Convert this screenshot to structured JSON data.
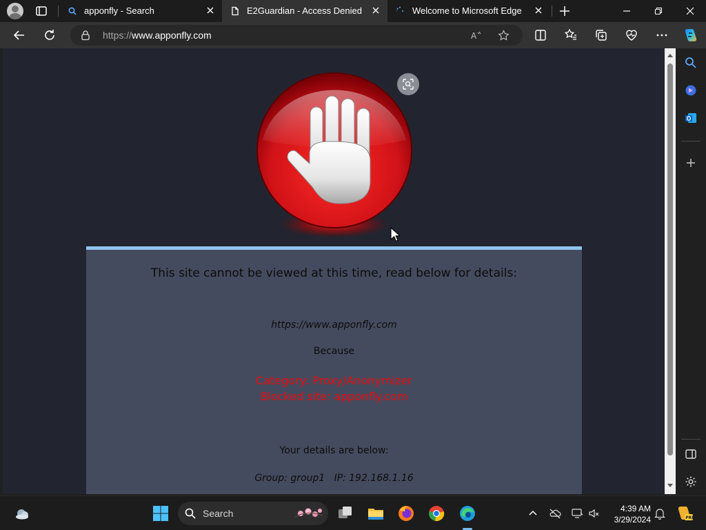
{
  "tabs": [
    {
      "title": "apponfly - Search",
      "icon": "search-icon",
      "active": false
    },
    {
      "title": "E2Guardian - Access Denied",
      "icon": "document-icon",
      "active": true
    },
    {
      "title": "Welcome to Microsoft Edge",
      "icon": "loading-icon",
      "active": false
    }
  ],
  "address_bar": {
    "scheme": "https://",
    "host": "www.apponfly.com"
  },
  "block_page": {
    "heading": "This site cannot be viewed at this time, read below for details:",
    "url": "https://www.apponfly.com",
    "because": "Because",
    "reason_line1": "Category: Proxy/Anonymizer",
    "reason_line2": "Blocked site: apponfly.com",
    "details_heading": "Your details are below:",
    "details": "Group: group1   IP: 192.168.1.16"
  },
  "taskbar": {
    "search_label": "Search",
    "time": "4:39 AM",
    "date": "3/29/2024"
  },
  "colors": {
    "page_background": "#222530",
    "panel_background": "#454b5e",
    "panel_top_border": "#8fc4ee",
    "reason_text": "#e80c10",
    "stop_sign_red": "#d01218"
  }
}
